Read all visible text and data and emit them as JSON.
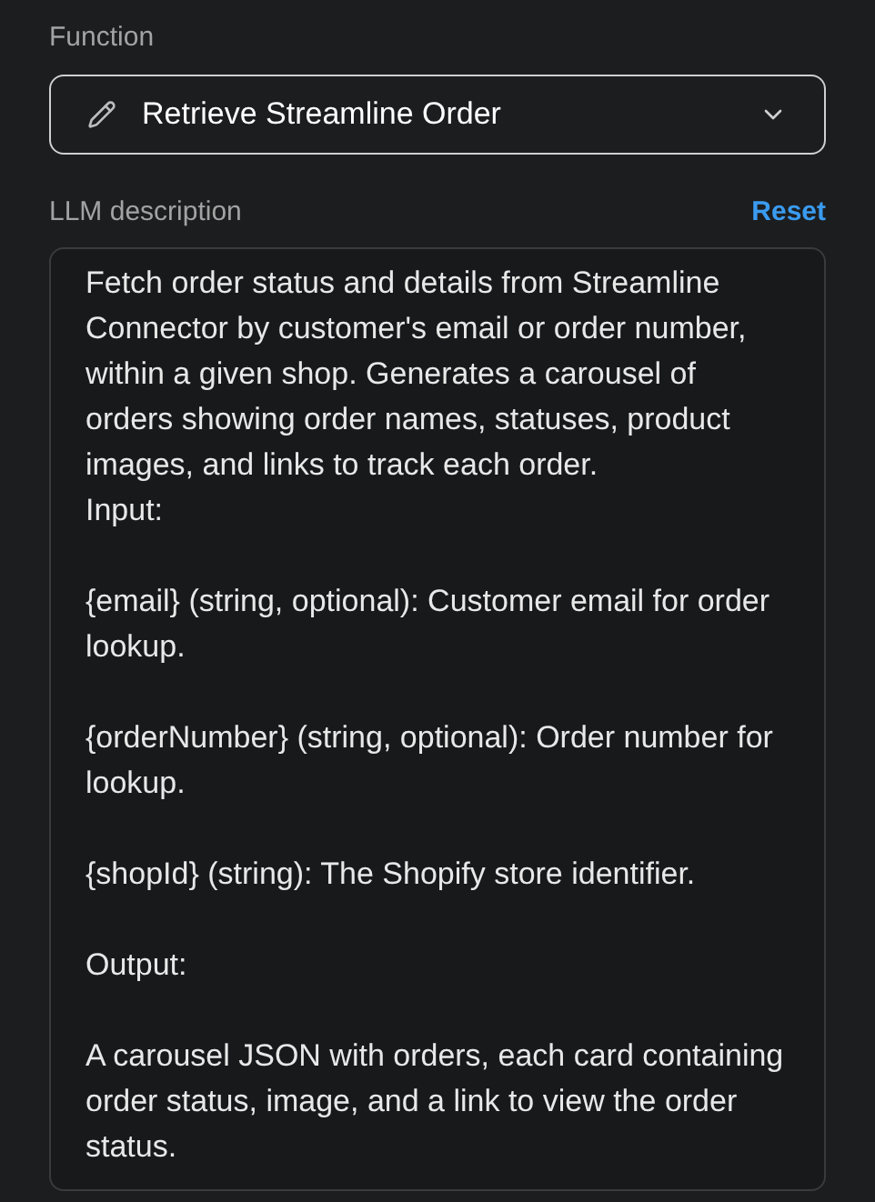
{
  "function": {
    "label": "Function",
    "value": "Retrieve Streamline Order"
  },
  "description": {
    "label": "LLM description",
    "reset": "Reset",
    "value": "Fetch order status and details from Streamline Connector by customer's email or order number, within a given shop. Generates a carousel of orders showing order names, statuses, product images, and links to track each order.\nInput:\n\n{email} (string, optional): Customer email for order lookup.\n\n{orderNumber} (string, optional): Order number for lookup.\n\n{shopId} (string): The Shopify store identifier.\n\nOutput:\n\nA carousel JSON with orders, each card containing order status, image, and a link to view the order status."
  }
}
